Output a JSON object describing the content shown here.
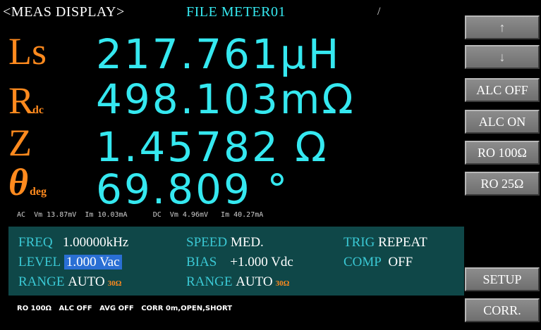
{
  "header": {
    "title": "<MEAS DISPLAY>",
    "file": "FILE METER01",
    "cursor": "/"
  },
  "readings": [
    {
      "param": "Ls",
      "sub": "",
      "value": "217.761μH"
    },
    {
      "param": "R",
      "sub": "dc",
      "value": "498.103mΩ"
    },
    {
      "param": "Z",
      "sub": "",
      "value": "1.45782  Ω"
    },
    {
      "param": "θ",
      "sub": "deg",
      "value": "69.809   °"
    }
  ],
  "monitor": {
    "ac_label": "AC",
    "ac_vm": "Vm 13.87mV",
    "ac_im": "Im 10.03mA",
    "dc_label": "DC",
    "dc_vm": "Vm 4.96mV",
    "dc_im": "Im 40.27mA"
  },
  "settings": {
    "freq_label": "FREQ",
    "freq_value": "1.00000kHz",
    "speed_label": "SPEED",
    "speed_value": "MED.",
    "trig_label": "TRIG",
    "trig_value": "REPEAT",
    "level_label": "LEVEL",
    "level_value": "1.000 Vac",
    "bias_label": "BIAS",
    "bias_value": "+1.000 Vdc",
    "comp_label": "COMP",
    "comp_value": "OFF",
    "range_ac_label": "RANGE",
    "range_ac_value": "AUTO",
    "range_ac_ohm": "30Ω",
    "range_dc_label": "RANGE",
    "range_dc_value": "AUTO",
    "range_dc_ohm": "30Ω"
  },
  "status": {
    "ro": "RO 100Ω",
    "alc": "ALC OFF",
    "avg": "AVG OFF",
    "corr": "CORR 0m,OPEN,SHORT"
  },
  "softkeys": {
    "up": "↑",
    "down": "↓",
    "alc_off": "ALC OFF",
    "alc_on": "ALC ON",
    "ro_100": "RO 100Ω",
    "ro_25": "RO 25Ω",
    "setup": "SETUP",
    "corr": "CORR."
  },
  "colors": {
    "background": "#000000",
    "value_cyan": "#35e8f0",
    "param_orange": "#ff8a1e",
    "panel_teal": "#0f4748",
    "highlight_blue": "#2a6fd4",
    "softkey_gray": "#7d7d7d"
  }
}
